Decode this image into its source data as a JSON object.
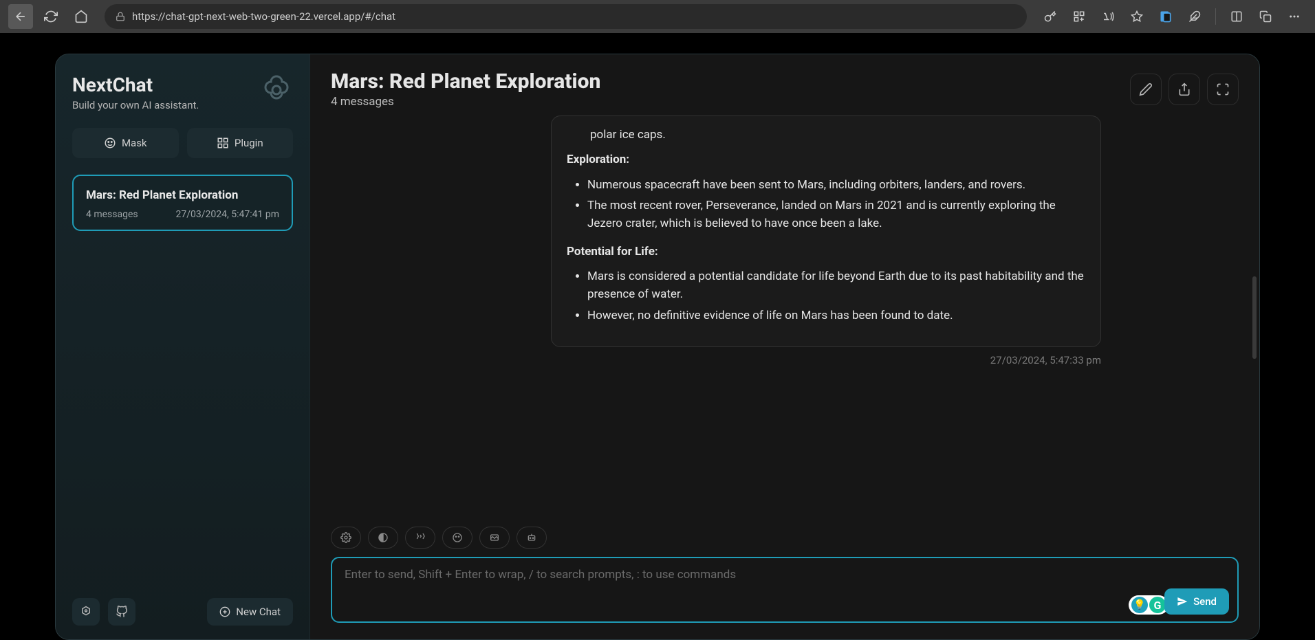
{
  "browser": {
    "url": "https://chat-gpt-next-web-two-green-22.vercel.app/#/chat"
  },
  "sidebar": {
    "title": "NextChat",
    "subtitle": "Build your own AI assistant.",
    "maskLabel": "Mask",
    "pluginLabel": "Plugin",
    "newChatLabel": "New Chat",
    "chats": [
      {
        "title": "Mars: Red Planet Exploration",
        "messages": "4 messages",
        "time": "27/03/2024, 5:47:41 pm"
      }
    ]
  },
  "main": {
    "title": "Mars: Red Planet Exploration",
    "subtitle": "4 messages",
    "message": {
      "cutoffLine": "polar ice caps.",
      "sections": [
        {
          "heading": "Exploration:",
          "bullets": [
            "Numerous spacecraft have been sent to Mars, including orbiters, landers, and rovers.",
            "The most recent rover, Perseverance, landed on Mars in 2021 and is currently exploring the Jezero crater, which is believed to have once been a lake."
          ]
        },
        {
          "heading": "Potential for Life:",
          "bullets": [
            "Mars is considered a potential candidate for life beyond Earth due to its past habitability and the presence of water.",
            "However, no definitive evidence of life on Mars has been found to date."
          ]
        }
      ],
      "timestamp": "27/03/2024, 5:47:33 pm"
    },
    "input": {
      "placeholder": "Enter to send, Shift + Enter to wrap, / to search prompts, : to use commands",
      "sendLabel": "Send"
    }
  }
}
